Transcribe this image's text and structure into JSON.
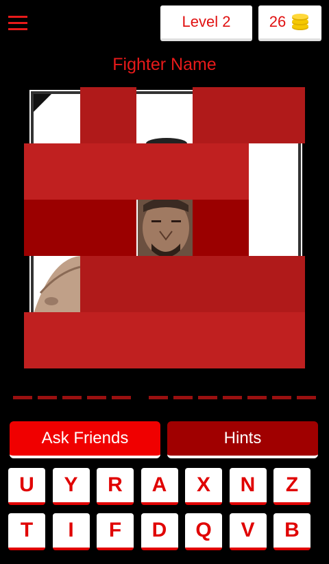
{
  "header": {
    "level_label": "Level 2",
    "coins": "26",
    "menu_icon": "hamburger-menu-icon",
    "coin_icon": "coin-stack-icon"
  },
  "title": "Fighter Name",
  "puzzle": {
    "rows": 5,
    "cols": 5,
    "revealed_tiles": [
      [
        0,
        0
      ],
      [
        0,
        2
      ],
      [
        1,
        4
      ],
      [
        2,
        2
      ],
      [
        2,
        4
      ],
      [
        3,
        0
      ]
    ]
  },
  "answer": {
    "word_lengths": [
      5,
      7
    ]
  },
  "buttons": {
    "ask_friends": "Ask Friends",
    "hints": "Hints"
  },
  "keyboard": {
    "row1": [
      "U",
      "Y",
      "R",
      "A",
      "X",
      "N",
      "Z"
    ],
    "row2": [
      "T",
      "I",
      "F",
      "D",
      "Q",
      "V",
      "B"
    ]
  },
  "colors": {
    "accent": "#e81a1a",
    "tile_dark": "#9b0000",
    "tile_mid": "#b01a1a",
    "tile_light": "#c02020",
    "hints_bg": "#a00000"
  }
}
